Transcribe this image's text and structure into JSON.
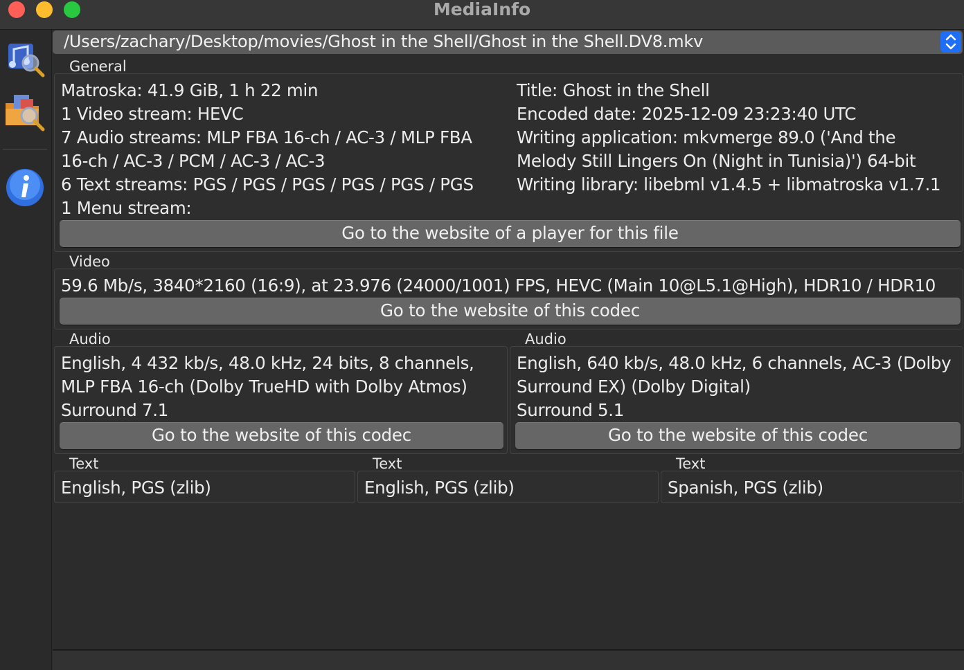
{
  "window": {
    "title": "MediaInfo"
  },
  "toolbar": {
    "items": [
      {
        "icon": "open-file-icon"
      },
      {
        "icon": "open-folder-icon"
      },
      {
        "icon": "about-info-icon"
      }
    ]
  },
  "path": {
    "value": "/Users/zachary/Desktop/movies/Ghost in the Shell/Ghost in the Shell.DV8.mkv"
  },
  "general": {
    "label": "General",
    "left_lines": [
      "Matroska: 41.9 GiB, 1 h 22 min",
      "1 Video stream: HEVC",
      "7 Audio streams: MLP FBA 16-ch / AC-3 / MLP FBA",
      "16-ch / AC-3 / PCM / AC-3 / AC-3",
      "6 Text streams: PGS / PGS / PGS / PGS / PGS / PGS",
      "1 Menu stream:"
    ],
    "right_lines": [
      "Title: Ghost in the Shell",
      "Encoded date: 2025-12-09 23:23:40 UTC",
      "Writing application: mkvmerge 89.0 ('And the",
      "Melody Still Lingers On (Night in Tunisia)') 64-bit",
      "Writing library: libebml v1.4.5 + libmatroska v1.7.1"
    ],
    "button": "Go to the website of a player for this file"
  },
  "video": {
    "label": "Video",
    "line": "59.6 Mb/s, 3840*2160 (16:9), at 23.976 (24000/1001) FPS, HEVC (Main 10@L5.1@High), HDR10 / HDR10",
    "button": "Go to the website of this codec"
  },
  "audio": [
    {
      "label": "Audio",
      "lines": [
        "English, 4 432 kb/s, 48.0 kHz, 24 bits, 8 channels,",
        "MLP FBA 16-ch (Dolby TrueHD with Dolby Atmos)",
        "Surround 7.1"
      ],
      "button": "Go to the website of this codec"
    },
    {
      "label": "Audio",
      "lines": [
        "English, 640 kb/s, 48.0 kHz, 6 channels, AC-3 (Dolby",
        "Surround EX) (Dolby Digital)",
        "Surround 5.1"
      ],
      "button": "Go to the website of this codec"
    }
  ],
  "text": [
    {
      "label": "Text",
      "line": "English, PGS (zlib)"
    },
    {
      "label": "Text",
      "line": "English, PGS (zlib)"
    },
    {
      "label": "Text",
      "line": "Spanish, PGS (zlib)"
    }
  ]
}
